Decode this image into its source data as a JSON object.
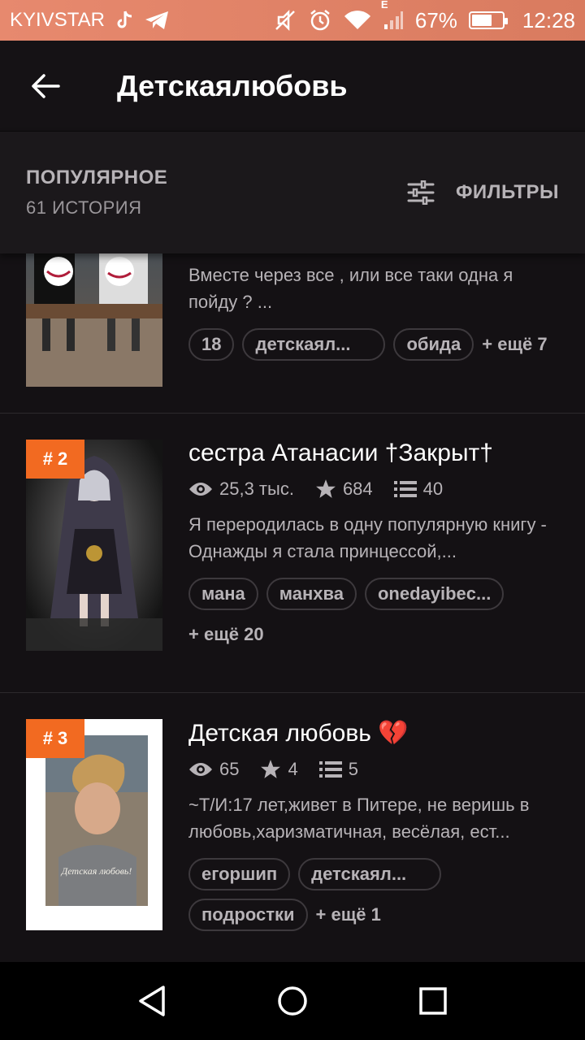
{
  "status_bar": {
    "carrier": "KYIVSTAR",
    "network_type": "E",
    "battery_percent": "67%",
    "battery_level": 0.67,
    "time": "12:28",
    "icons": [
      "tiktok-icon",
      "telegram-icon",
      "mute-icon",
      "alarm-icon",
      "wifi-icon",
      "signal-icon",
      "battery-icon"
    ]
  },
  "app_bar": {
    "title": "Детскаялюбовь",
    "back_icon": "arrow-left-icon"
  },
  "list_header": {
    "sort_label": "ПОПУЛЯРНОЕ",
    "count_label": "61 ИСТОРИЯ",
    "filters_label": "ФИЛЬТРЫ",
    "filters_icon": "sliders-icon"
  },
  "stories": [
    {
      "description": "Вместе через все , или все таки одна я пойду ? ...",
      "tags": [
        "18",
        "детскаял...",
        "обида"
      ],
      "more": "+ ещё 7"
    },
    {
      "rank": "# 2",
      "title": "сестра Атанасии †Закрыт†",
      "views": "25,3 тыс.",
      "votes": "684",
      "parts": "40",
      "description": "Я переродилась в одну популярную книгу - Однажды я стала принцессой,...",
      "tags": [
        "мана",
        "манхва",
        "onedayibec..."
      ],
      "more": "+ ещё 20"
    },
    {
      "rank": "# 3",
      "title": "Детская любовь 💔",
      "views": "65",
      "votes": "4",
      "parts": "5",
      "description": "~Т/И:17 лет,живет в Питере, не веришь в любовь,харизматичная, весёлая, ест...",
      "tags": [
        "егоршип",
        "детскаял...",
        "подростки"
      ],
      "more": "+ ещё 1",
      "cover_caption": "Детская любовь!"
    }
  ],
  "nav_bar": {
    "icons": [
      "back-triangle-icon",
      "home-circle-icon",
      "recents-square-icon"
    ]
  },
  "colors": {
    "status_bar": "#e7896e",
    "background": "#141114",
    "rank_badge": "#f26a21",
    "text_secondary": "#b7b3b7"
  }
}
